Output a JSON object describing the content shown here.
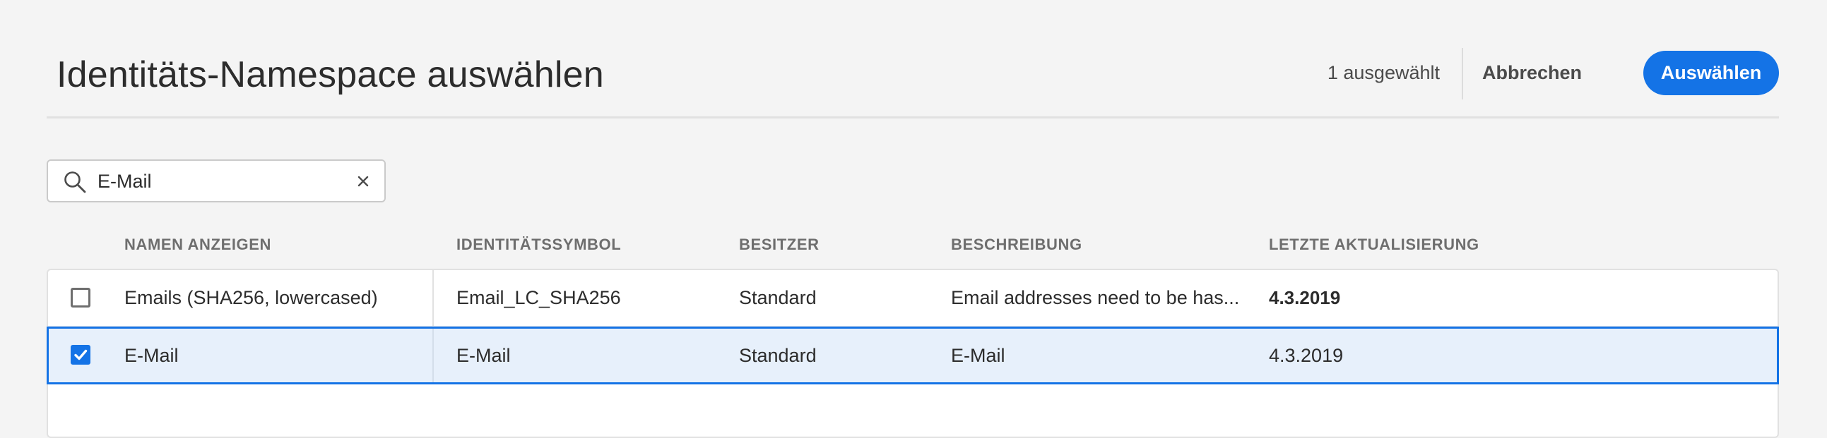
{
  "header": {
    "title": "Identitäts-Namespace auswählen",
    "selected_count": "1 ausgewählt",
    "cancel_label": "Abbrechen",
    "select_label": "Auswählen"
  },
  "search": {
    "value": "E-Mail"
  },
  "table": {
    "columns": [
      "NAMEN ANZEIGEN",
      "IDENTITÄTSSYMBOL",
      "BESITZER",
      "BESCHREIBUNG",
      "LETZTE AKTUALISIERUNG"
    ],
    "rows": [
      {
        "checked": false,
        "name": "Emails (SHA256, lowercased)",
        "symbol": "Email_LC_SHA256",
        "owner": "Standard",
        "description": "Email addresses need to be has...",
        "updated": "4.3.2019"
      },
      {
        "checked": true,
        "name": "E-Mail",
        "symbol": "E-Mail",
        "owner": "Standard",
        "description": "E-Mail",
        "updated": "4.3.2019"
      }
    ]
  },
  "colors": {
    "accent": "#1473e6",
    "selected_row_bg": "#e7f0fb",
    "page_bg": "#f4f4f4"
  }
}
